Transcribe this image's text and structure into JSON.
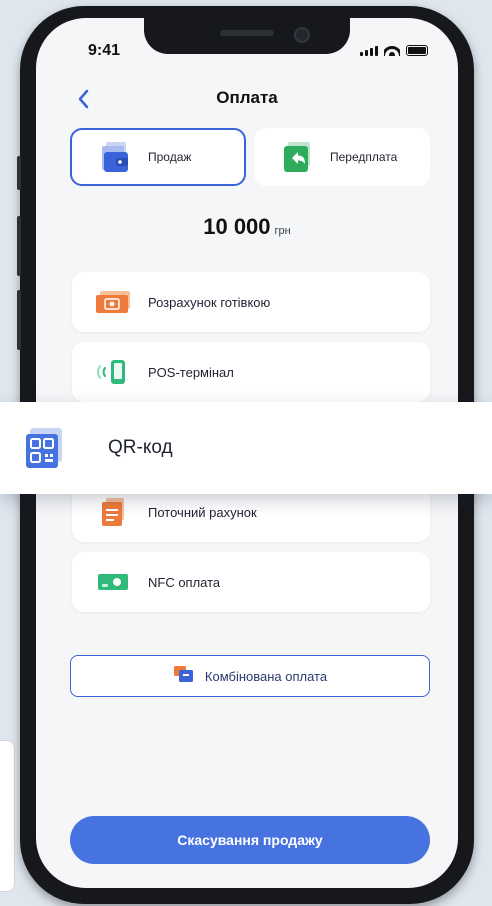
{
  "status_bar": {
    "time": "9:41"
  },
  "header": {
    "title": "Оплата",
    "back_icon": "chevron-left-icon"
  },
  "tabs": [
    {
      "label": "Продаж",
      "icon": "wallet-icon",
      "active": true
    },
    {
      "label": "Передплата",
      "icon": "return-icon",
      "active": false
    }
  ],
  "amount": {
    "value": "10 000",
    "currency": "грн"
  },
  "payment_methods": [
    {
      "label": "Розрахунок готівкою",
      "icon": "cash-icon"
    },
    {
      "label": "POS-термінал",
      "icon": "pos-terminal-icon"
    },
    {
      "label": "Поточний рахунок",
      "icon": "document-icon"
    },
    {
      "label": "NFC оплата",
      "icon": "nfc-icon"
    }
  ],
  "qr_overlay": {
    "label": "QR-код",
    "icon": "qr-code-icon"
  },
  "combined_button": {
    "label": "Комбінована оплата",
    "icon": "combined-payment-icon"
  },
  "cancel_button": {
    "label": "Скасування продажу"
  },
  "colors": {
    "accent": "#3b63d8",
    "button": "#4773e0",
    "cash": "#f07a3a",
    "prepay": "#2eab5b",
    "nfc": "#2fb97a"
  }
}
